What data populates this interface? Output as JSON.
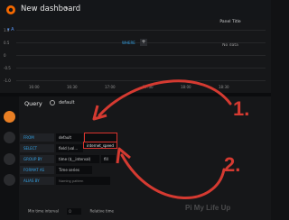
{
  "header": {
    "dashboard_title": "New dashboard"
  },
  "panel": {
    "title": "Panel Title",
    "no_data": "No data",
    "y_labels": [
      "1.0",
      "0.5",
      "0",
      "-0.5",
      "-1.0"
    ],
    "x_labels": [
      "16:00",
      "16:30",
      "17:00",
      "17:30",
      "18:00",
      "18:30"
    ]
  },
  "query": {
    "label": "Query",
    "datasource": "default",
    "row_name": "A",
    "from_label": "FROM",
    "from_value": "default",
    "where_label": "WHERE",
    "select_label": "SELECT",
    "select_value": "field (val...",
    "group_by_label": "GROUP BY",
    "group_by_value": "time ($__interval)",
    "group_by_fill": "fill",
    "format_label": "FORMAT AS",
    "format_value": "Time series",
    "alias_label": "ALIAS BY",
    "alias_placeholder": "Naming pattern",
    "measurement_option": "internet_speed",
    "min_interval_label": "Min time interval",
    "min_interval_value": "0",
    "relative_time_label": "Relative time"
  },
  "annotations": {
    "step1": "1.",
    "step2": "2."
  },
  "watermark": "Pi My Life Up",
  "colors": {
    "accent": "#e97f24",
    "annotation_red": "#d53a31",
    "label_blue": "#33a2e5"
  }
}
